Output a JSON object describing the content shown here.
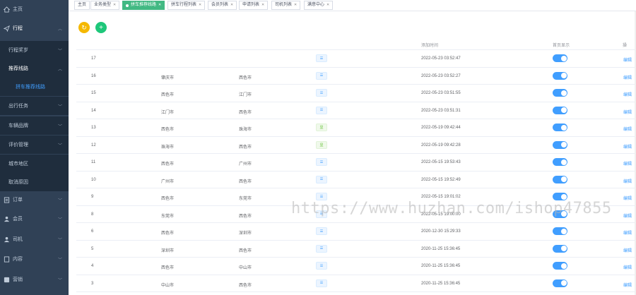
{
  "sidebar": {
    "items": [
      {
        "label": "主页",
        "icon": "home-icon"
      },
      {
        "label": "行程",
        "icon": "send-icon"
      },
      {
        "label": "行程奖岁"
      },
      {
        "label": "推荐线路"
      },
      {
        "label": "拼车推荐线路"
      },
      {
        "label": "出行任务"
      },
      {
        "label": "车辆品牌"
      },
      {
        "label": "评价管理"
      },
      {
        "label": "城市地区"
      },
      {
        "label": "取消原因"
      },
      {
        "label": "订单",
        "icon": "list-icon"
      },
      {
        "label": "会员",
        "icon": "user-icon"
      },
      {
        "label": "司机",
        "icon": "driver-icon"
      },
      {
        "label": "内容",
        "icon": "doc-icon"
      },
      {
        "label": "营销",
        "icon": "marketing-icon"
      }
    ]
  },
  "tabs": [
    {
      "label": "主页"
    },
    {
      "label": "业务类型"
    },
    {
      "label": "拼车推荐线路"
    },
    {
      "label": "拼车行程列表"
    },
    {
      "label": "会员列表"
    },
    {
      "label": "申请列表"
    },
    {
      "label": "司机列表"
    },
    {
      "label": "满意中心"
    }
  ],
  "actions": {
    "refresh_icon": "rotate-icon",
    "add_icon": "plus-icon",
    "add_label": "+"
  },
  "table": {
    "headers": {
      "time": "添加时间",
      "home": "首页显示",
      "ops": "操"
    },
    "tag_text": "☰",
    "tag_text_b": "显",
    "edit_label": "编辑",
    "rows": [
      {
        "id": "17",
        "from": "",
        "to": "",
        "tag": "blue",
        "time": "2022-05-23 03:52:47"
      },
      {
        "id": "16",
        "from": "肇庆市",
        "to": "西色市",
        "tag": "blue",
        "time": "2022-05-23 03:52:27"
      },
      {
        "id": "15",
        "from": "西色市",
        "to": "江门市",
        "tag": "blue",
        "time": "2022-05-23 03:51:55"
      },
      {
        "id": "14",
        "from": "江门市",
        "to": "西色市",
        "tag": "blue",
        "time": "2022-05-23 03:51:31"
      },
      {
        "id": "13",
        "from": "西色市",
        "to": "珠海市",
        "tag": "green",
        "time": "2022-05-19 09:42:44"
      },
      {
        "id": "12",
        "from": "珠海市",
        "to": "西色市",
        "tag": "green",
        "time": "2022-05-19 09:42:28"
      },
      {
        "id": "11",
        "from": "西色市",
        "to": "广州市",
        "tag": "blue",
        "time": "2022-05-15 19:53:43"
      },
      {
        "id": "10",
        "from": "广州市",
        "to": "西色市",
        "tag": "blue",
        "time": "2022-05-15 19:52:49"
      },
      {
        "id": "9",
        "from": "西色市",
        "to": "东莞市",
        "tag": "blue",
        "time": "2022-05-15 19:01:02"
      },
      {
        "id": "8",
        "from": "东莞市",
        "to": "西色市",
        "tag": "blue",
        "time": "2022-05-15 19:00:00"
      },
      {
        "id": "6",
        "from": "西色市",
        "to": "深圳市",
        "tag": "blue",
        "time": "2020-12-30 15:29:33"
      },
      {
        "id": "5",
        "from": "深圳市",
        "to": "西色市",
        "tag": "blue",
        "time": "2020-11-25 15:36:45"
      },
      {
        "id": "4",
        "from": "西色市",
        "to": "中山市",
        "tag": "blue",
        "time": "2020-11-25 15:36:45"
      },
      {
        "id": "3",
        "from": "中山市",
        "to": "西色市",
        "tag": "blue",
        "time": "2020-11-25 15:36:45"
      }
    ]
  },
  "watermark": "https://www.huzhan.com/ishop47855",
  "colors": {
    "sidebar_bg": "#304156",
    "accent": "#409eff",
    "active_tab": "#42b983",
    "refresh": "#f5b800",
    "add": "#1ec77a"
  }
}
